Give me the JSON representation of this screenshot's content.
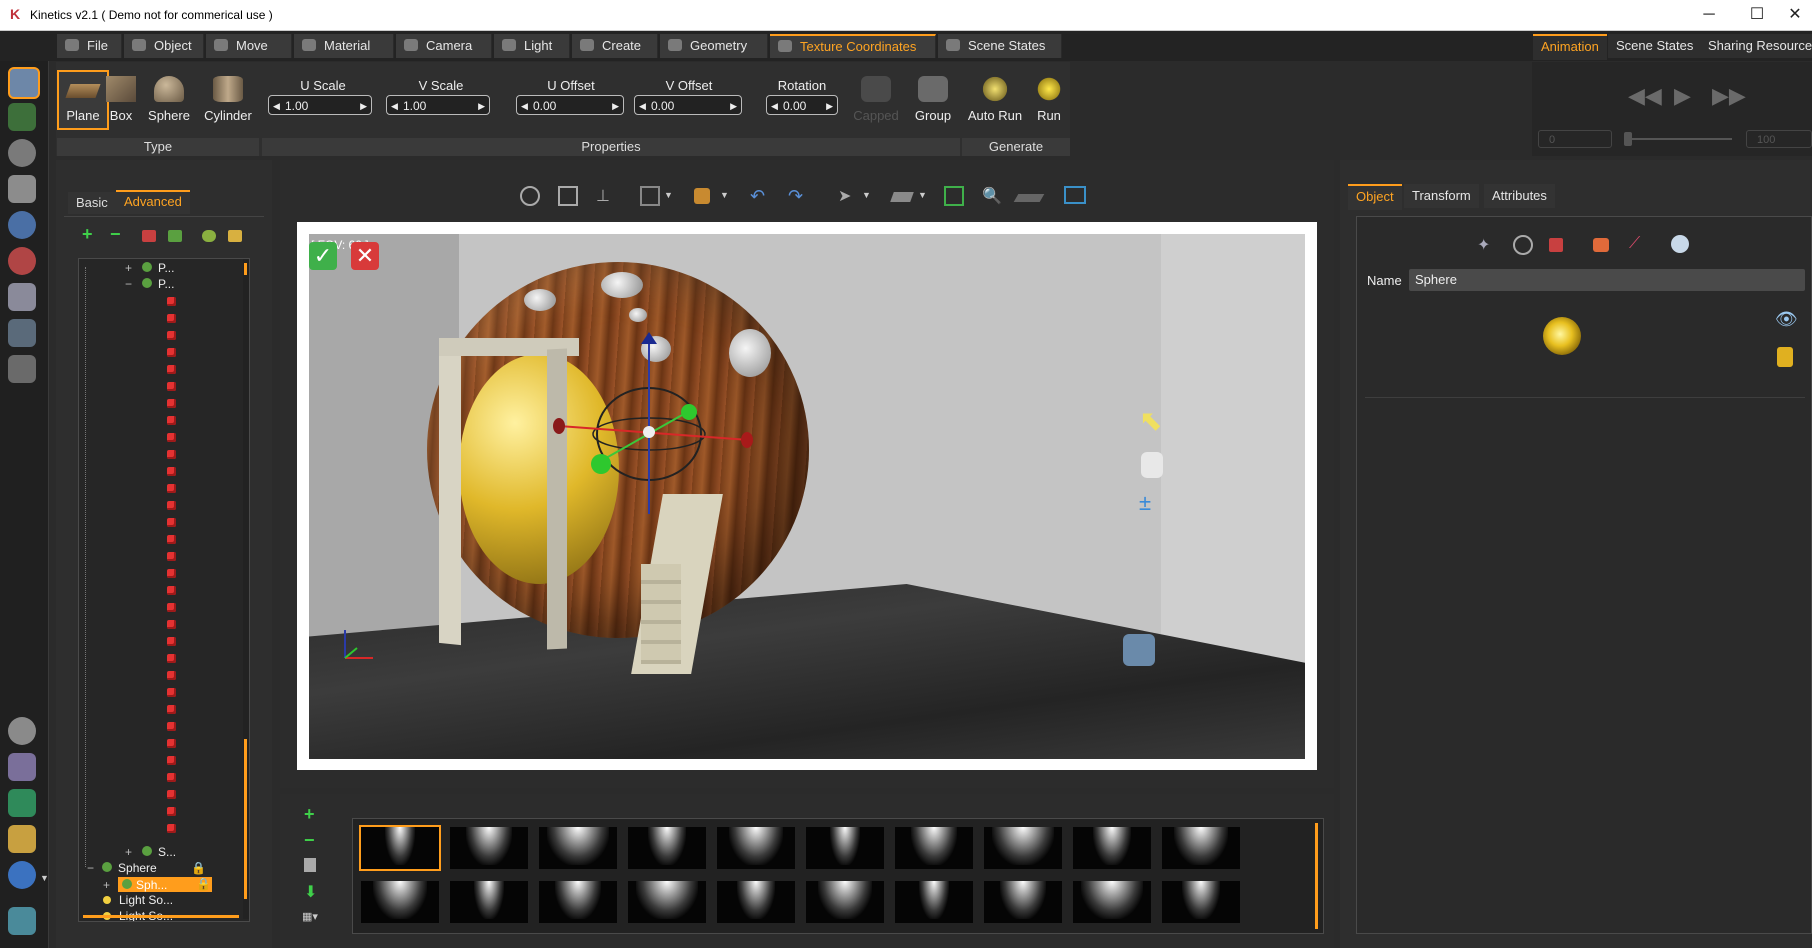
{
  "window": {
    "title": "Kinetics v2.1 ( Demo not for commerical use )",
    "minimize": "─",
    "maximize": "☐",
    "close": "✕"
  },
  "menu_tabs": [
    {
      "label": "File",
      "icon": "file-icon"
    },
    {
      "label": "Object",
      "icon": "object-icon"
    },
    {
      "label": "Move",
      "icon": "move-icon"
    },
    {
      "label": "Material",
      "icon": "material-icon"
    },
    {
      "label": "Camera",
      "icon": "camera-icon"
    },
    {
      "label": "Light",
      "icon": "light-icon"
    },
    {
      "label": "Create",
      "icon": "create-icon"
    },
    {
      "label": "Geometry",
      "icon": "geometry-icon"
    },
    {
      "label": "Texture Coordinates",
      "icon": "texture-icon",
      "active": true
    },
    {
      "label": "Scene States",
      "icon": "scene-states-icon"
    }
  ],
  "right_tabs": [
    {
      "label": "Animation",
      "active": true
    },
    {
      "label": "Scene States"
    },
    {
      "label": "Sharing Resource"
    }
  ],
  "ribbon": {
    "type_tools": [
      "Plane",
      "Box",
      "Sphere",
      "Cylinder"
    ],
    "properties": [
      {
        "label": "U Scale",
        "value": "1.00"
      },
      {
        "label": "V Scale",
        "value": "1.00"
      },
      {
        "label": "U Offset",
        "value": "0.00"
      },
      {
        "label": "V Offset",
        "value": "0.00"
      },
      {
        "label": "Rotation",
        "value": "0.00"
      }
    ],
    "generate_tools": [
      "Capped",
      "Group",
      "Auto Run",
      "Run"
    ],
    "sections": {
      "type": "Type",
      "properties": "Properties",
      "generate": "Generate"
    }
  },
  "animation": {
    "frame_start": "0",
    "frame_end": "100"
  },
  "left_panel": {
    "tabs": [
      {
        "label": "Basic"
      },
      {
        "label": "Advanced",
        "active": true
      }
    ],
    "tree": {
      "p1": "P...",
      "p2": "P...",
      "s": "S...",
      "sphere": "Sphere",
      "sph": "Sph...",
      "light1": "Light So...",
      "light2": "Light So..."
    }
  },
  "viewport": {
    "camera_label": "[ FOV: 60 ]"
  },
  "right_panel": {
    "tabs": [
      {
        "label": "Object",
        "active": true
      },
      {
        "label": "Transform"
      },
      {
        "label": "Attributes"
      }
    ],
    "name_label": "Name",
    "name_value": "Sphere"
  },
  "thumbnails": {
    "rows": 2,
    "cols": 10
  },
  "colors": {
    "accent": "#ff9d1c",
    "background": "#2b2b2b",
    "panel": "#2e2e2e"
  }
}
